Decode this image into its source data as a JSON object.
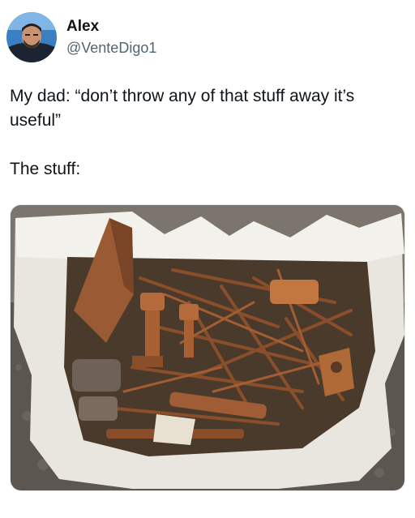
{
  "author": {
    "display_name": "Alex",
    "handle": "@VenteDigo1"
  },
  "tweet": {
    "paragraphs": [
      "My dad: “don’t throw any of that stuff away it’s useful”",
      "The stuff:"
    ]
  },
  "media": {
    "description_icon": "photo-icon"
  }
}
